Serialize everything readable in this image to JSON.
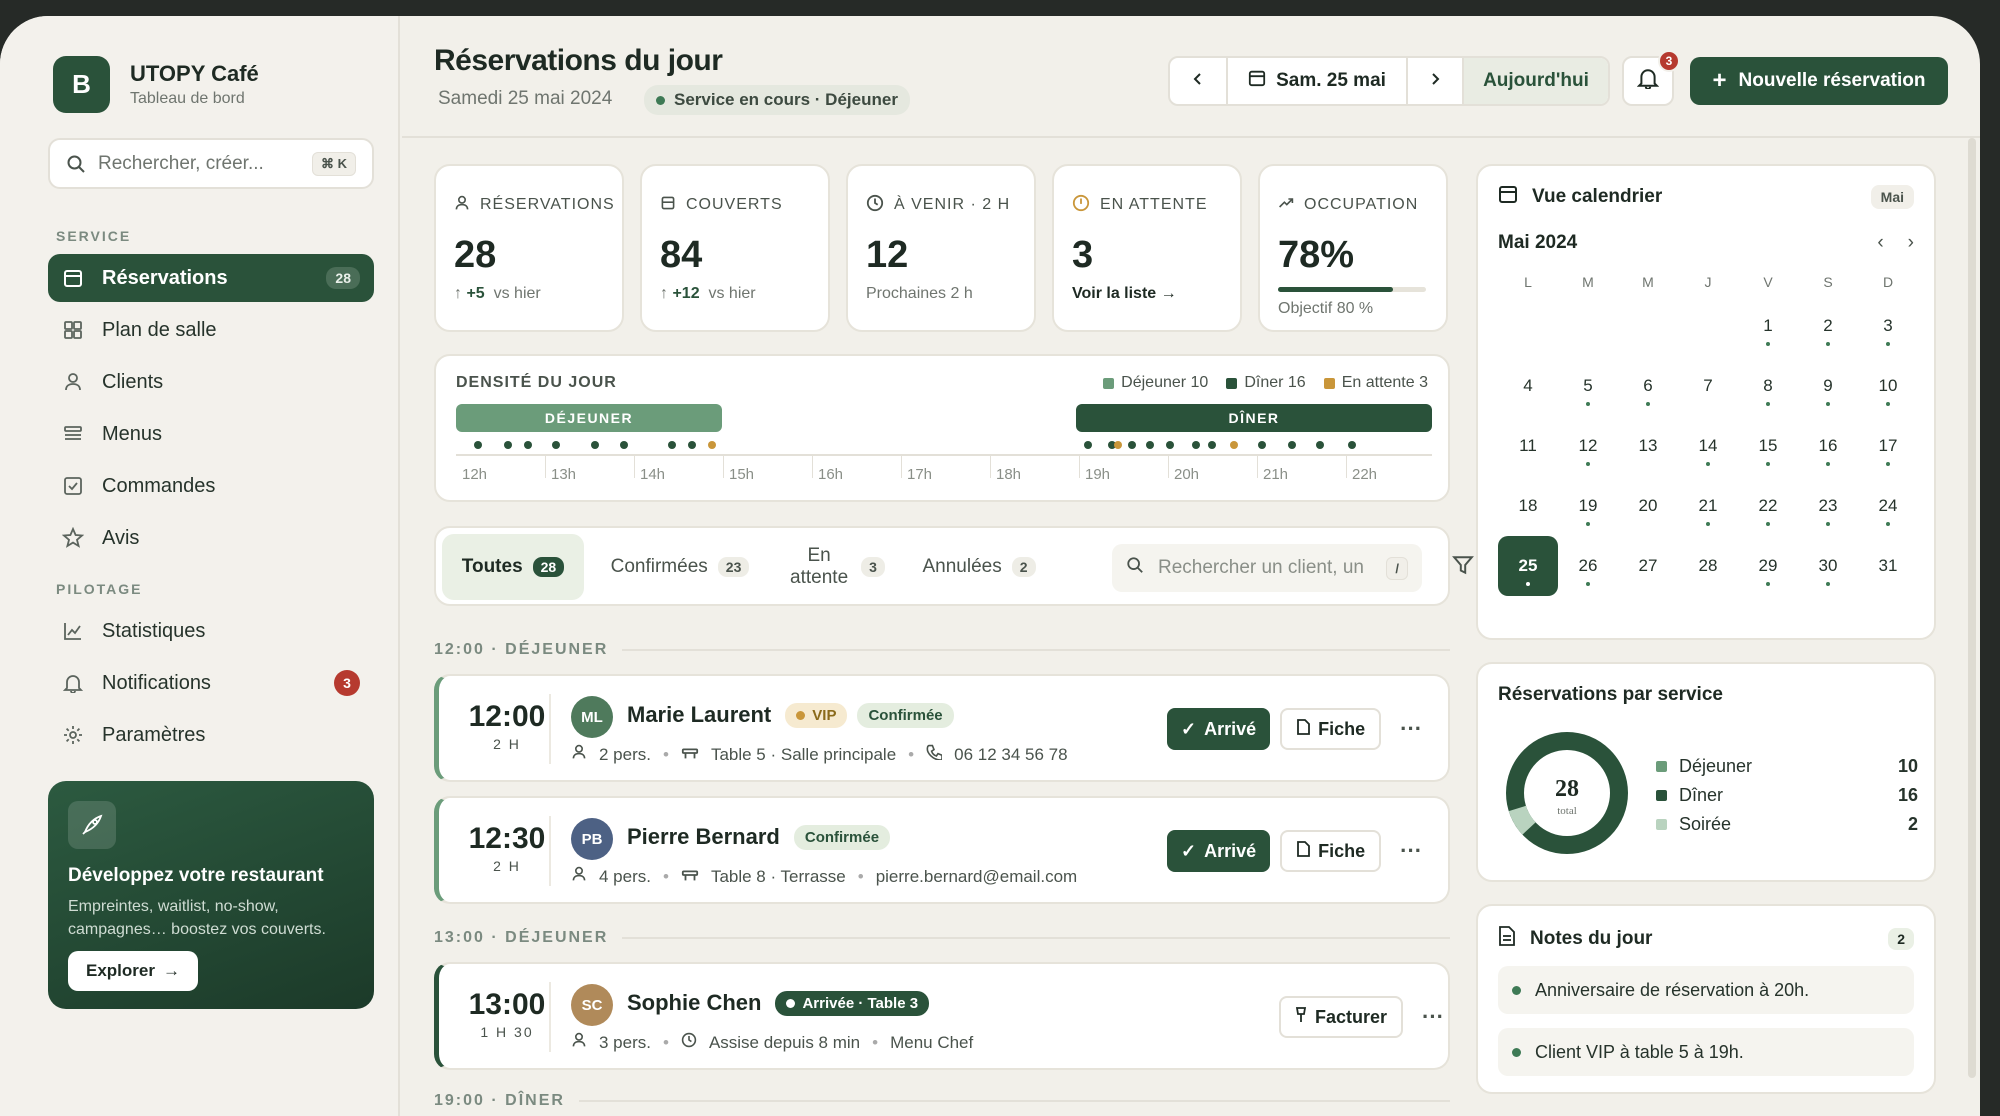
{
  "brand": {
    "logo": "B",
    "name": "UTOPY Café",
    "subtitle": "Tableau de bord"
  },
  "sidebar": {
    "search_placeholder": "Rechercher, créer...",
    "search_shortcut": "⌘ K",
    "section_service": "SERVICE",
    "section_pilotage": "PILOTAGE",
    "items": [
      {
        "label": "Réservations",
        "count": "28",
        "icon": "calendar-icon"
      },
      {
        "label": "Plan de salle",
        "icon": "grid-icon"
      },
      {
        "label": "Clients",
        "icon": "user-icon"
      },
      {
        "label": "Menus",
        "icon": "list-icon"
      },
      {
        "label": "Commandes",
        "icon": "checklist-icon"
      },
      {
        "label": "Avis",
        "icon": "star-icon"
      },
      {
        "label": "Statistiques",
        "icon": "chart-icon"
      },
      {
        "label": "Notifications",
        "count": "3",
        "icon": "bell-icon"
      },
      {
        "label": "Paramètres",
        "icon": "gear-icon"
      }
    ],
    "promo": {
      "title": "Développez votre restaurant",
      "text": "Empreintes, waitlist, no-show, campagnes… boostez vos couverts.",
      "button": "Explorer"
    }
  },
  "header": {
    "title": "Réservations du jour",
    "date": "Samedi 25 mai 2024",
    "service_status": "Service en cours · Déjeuner",
    "current_date": "Sam. 25 mai",
    "today_label": "Aujourd'hui",
    "notif_count": "3",
    "new_button": "Nouvelle réservation"
  },
  "kpis": [
    {
      "label": "RÉSERVATIONS",
      "value": "28",
      "delta": "+5",
      "note": "vs hier"
    },
    {
      "label": "COUVERTS",
      "value": "84",
      "delta": "+12",
      "note": "vs hier"
    },
    {
      "label": "À VENIR · 2 H",
      "value": "12",
      "note": "Prochaines 2 h"
    },
    {
      "label": "EN ATTENTE",
      "value": "3",
      "link": "Voir la liste →"
    },
    {
      "label": "OCCUPATION",
      "value": "78%",
      "progress": 0.78,
      "note": "Objectif 80 %"
    }
  ],
  "density": {
    "title": "DENSITÉ DU JOUR",
    "legend": [
      "Déjeuner 10",
      "Dîner 16",
      "En attente 3"
    ],
    "bands": [
      "DÉJEUNER",
      "DÎNER"
    ],
    "ticks": [
      "12h",
      "13h",
      "14h",
      "15h",
      "16h",
      "17h",
      "18h",
      "19h",
      "20h",
      "21h",
      "22h"
    ],
    "colors": {
      "lunch": "#6b9c7a",
      "dinner": "#2a523a",
      "waiting": "#c9963a"
    }
  },
  "filters": {
    "tabs": [
      {
        "label": "Toutes",
        "count": "28"
      },
      {
        "label": "Confirmées",
        "count": "23"
      },
      {
        "label": "En attente",
        "count": "3"
      },
      {
        "label": "Annulées",
        "count": "2"
      }
    ],
    "search_placeholder": "Rechercher un client, un",
    "search_shortcut": "/"
  },
  "groups": [
    "12:00 · DÉJEUNER",
    "13:00 · DÉJEUNER",
    "19:00 · DÎNER"
  ],
  "reservations": [
    {
      "time": "12:00",
      "duration": "2 H",
      "initials": "ML",
      "name": "Marie Laurent",
      "vip": "VIP",
      "status": "Confirmée",
      "guests": "2 pers.",
      "table": "Table 5 · Salle principale",
      "contact": "06 12 34 56 78",
      "primary": "Arrivé",
      "secondary": "Fiche"
    },
    {
      "time": "12:30",
      "duration": "2 H",
      "initials": "PB",
      "name": "Pierre Bernard",
      "status": "Confirmée",
      "guests": "4 pers.",
      "table": "Table 8 · Terrasse",
      "contact": "pierre.bernard@email.com",
      "primary": "Arrivé",
      "secondary": "Fiche"
    },
    {
      "time": "13:00",
      "duration": "1 H 30",
      "initials": "SC",
      "name": "Sophie Chen",
      "status": "Arrivée · Table 3",
      "guests": "3 pers.",
      "seated": "Assise depuis 8 min",
      "menu": "Menu Chef",
      "primary": "Facturer"
    }
  ],
  "calendar": {
    "title": "Vue calendrier",
    "badge": "Mai",
    "month": "Mai 2024",
    "weekdays": [
      "L",
      "M",
      "M",
      "J",
      "V",
      "S",
      "D"
    ],
    "selected": 25
  },
  "by_service": {
    "title": "Réservations par service",
    "total": "28",
    "total_label": "total",
    "rows": [
      {
        "label": "Déjeuner",
        "value": "10",
        "color": "#6b9c7a"
      },
      {
        "label": "Dîner",
        "value": "16",
        "color": "#2a523a"
      },
      {
        "label": "Soirée",
        "value": "2",
        "color": "#b9d3bf"
      }
    ]
  },
  "notes": {
    "title": "Notes du jour",
    "count": "2",
    "items": [
      "Anniversaire de réservation à 20h.",
      "Client VIP à table 5 à 19h."
    ]
  }
}
